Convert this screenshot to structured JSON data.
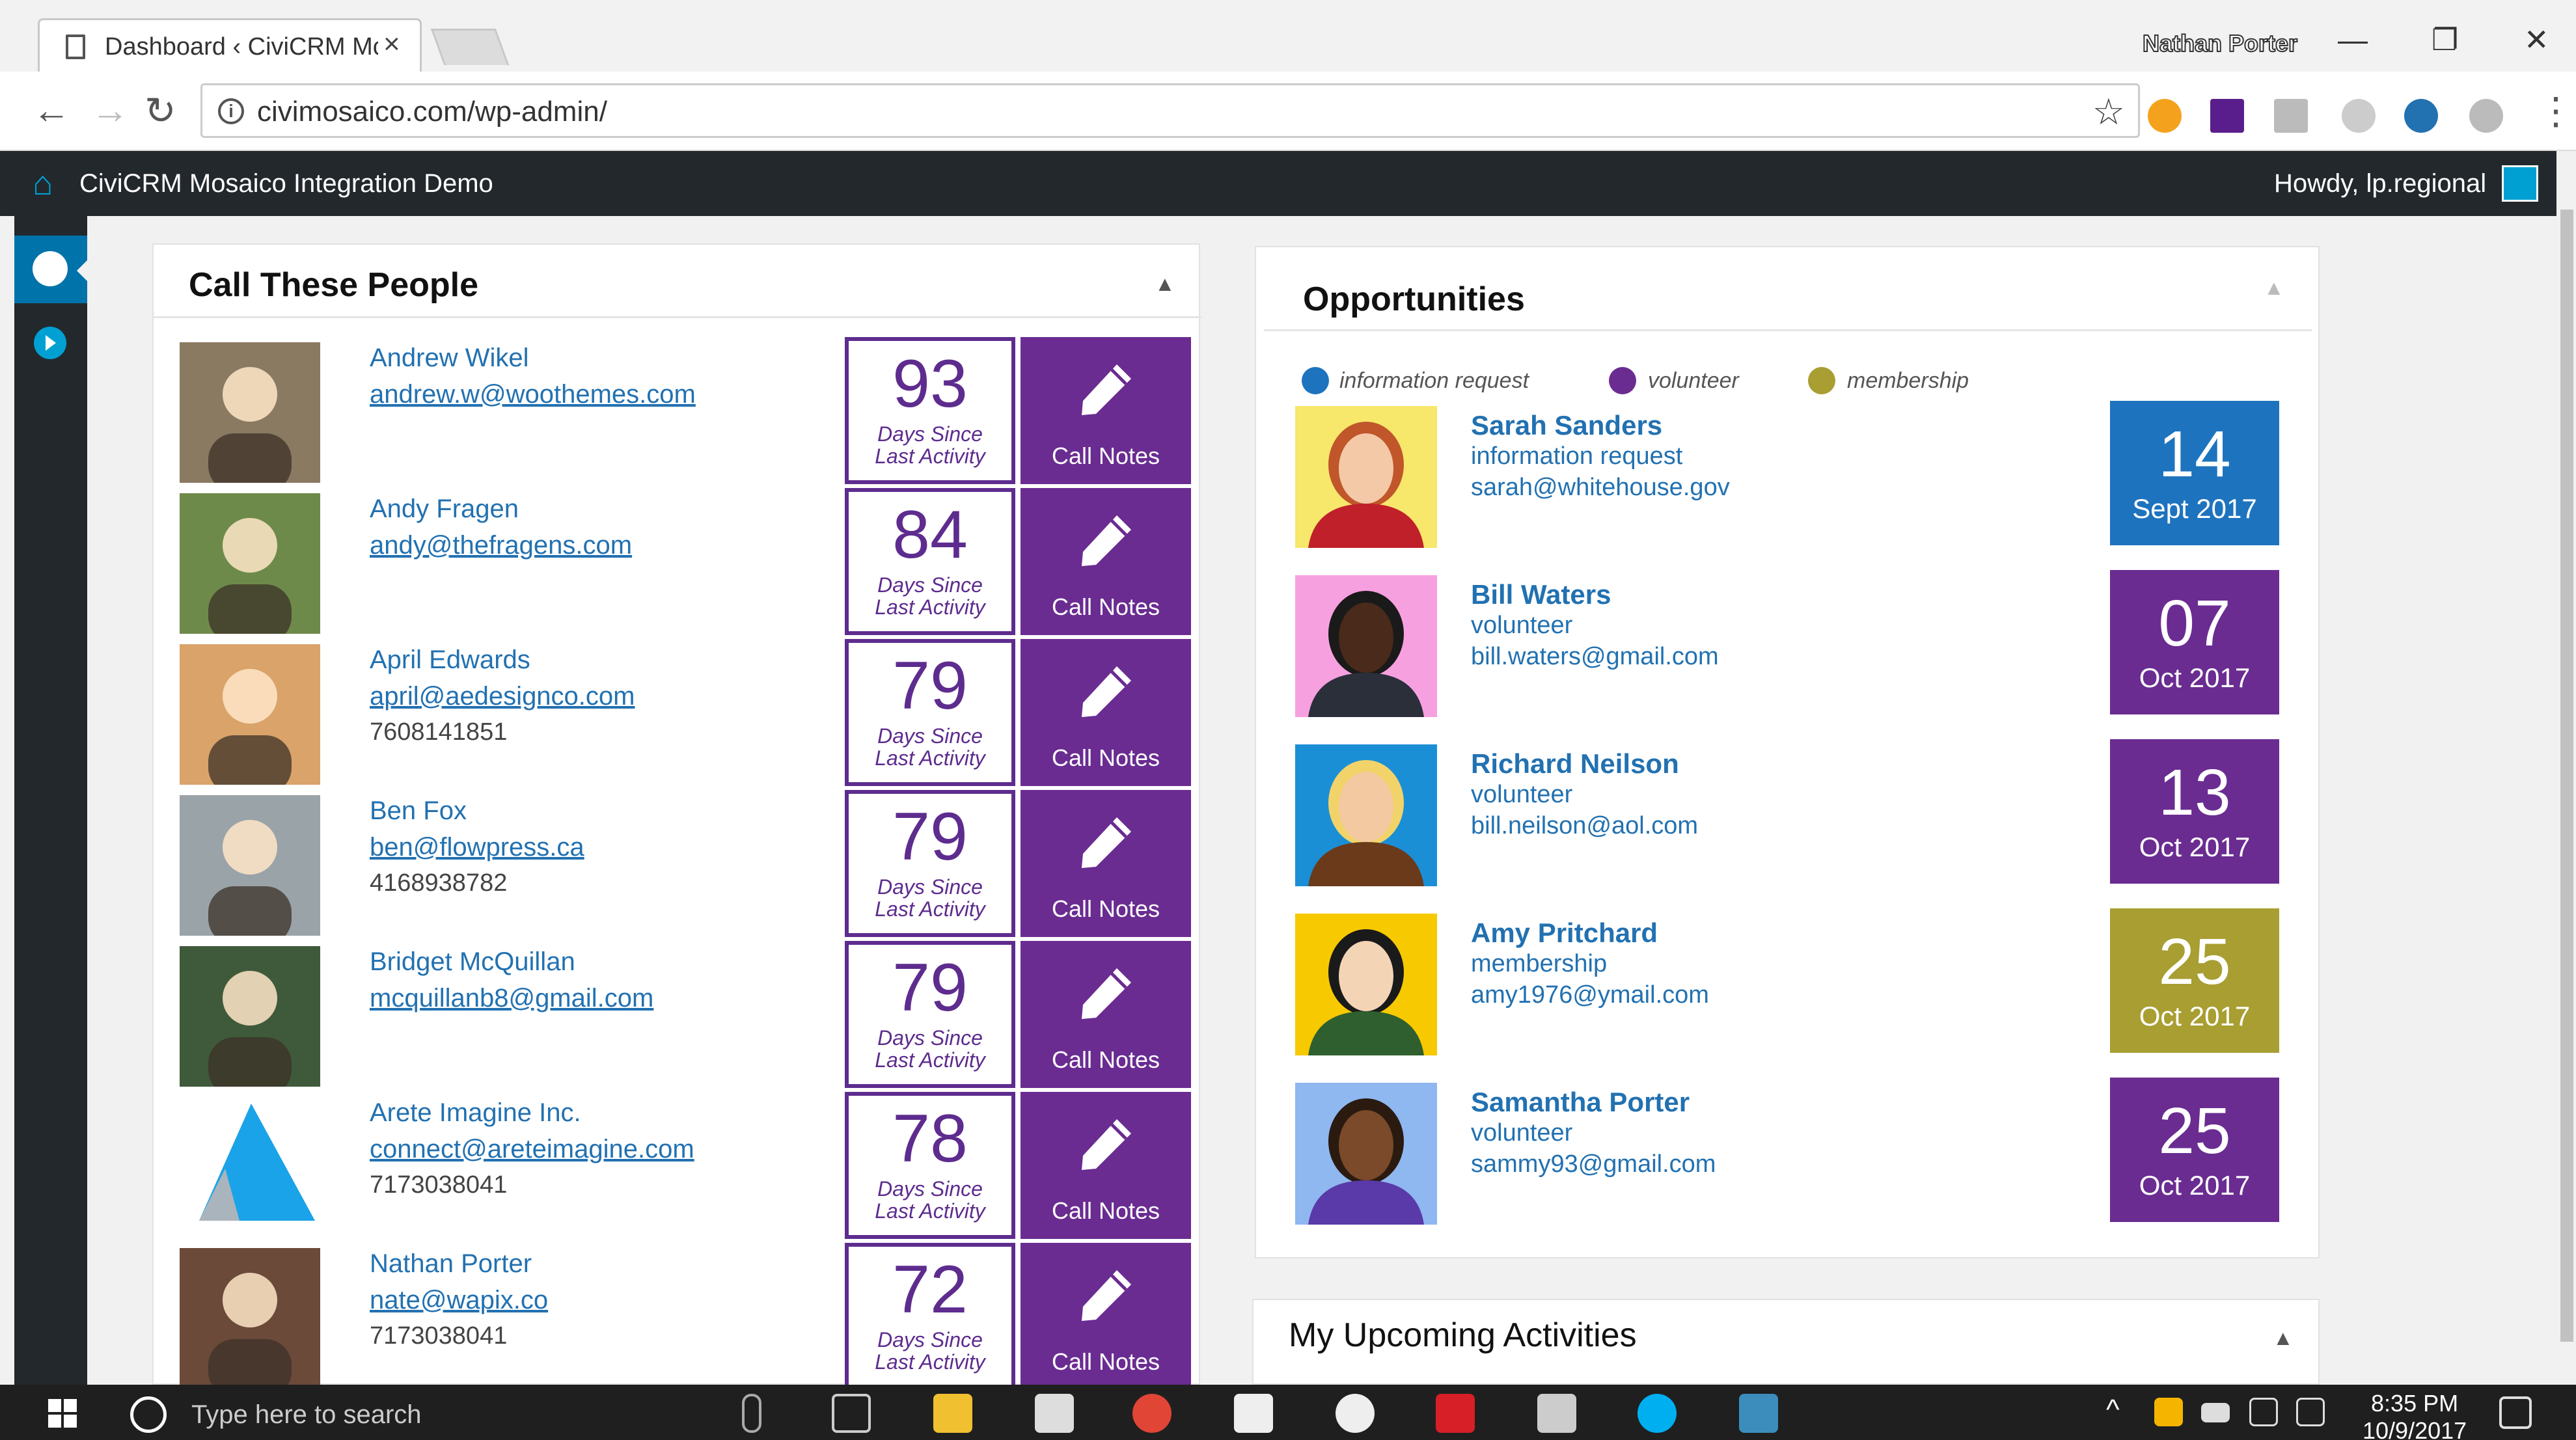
{
  "browser": {
    "tab_title": "Dashboard ‹ CiviCRM Mc",
    "tab_close": "×",
    "profile_name": "Nathan Porter",
    "url": "civimosaico.com/wp-admin/"
  },
  "adminbar": {
    "site_name": "CiviCRM Mosaico Integration Demo",
    "howdy": "Howdy, lp.regional"
  },
  "call_panel": {
    "title": "Call These People",
    "days_label_1": "Days Since",
    "days_label_2": "Last Activity",
    "notes_label": "Call Notes",
    "people": [
      {
        "name": "Andrew Wikel",
        "email": "andrew.w@woothemes.com",
        "phone": "",
        "days": "93"
      },
      {
        "name": "Andy Fragen",
        "email": "andy@thefragens.com",
        "phone": "",
        "days": "84"
      },
      {
        "name": "April Edwards",
        "email": "april@aedesignco.com",
        "phone": "7608141851",
        "days": "79"
      },
      {
        "name": "Ben Fox",
        "email": "ben@flowpress.ca",
        "phone": "4168938782",
        "days": "79"
      },
      {
        "name": "Bridget McQuillan",
        "email": "mcquillanb8@gmail.com",
        "phone": "",
        "days": "79"
      },
      {
        "name": "Arete Imagine Inc.",
        "email": "connect@areteimagine.com",
        "phone": "7173038041",
        "days": "78"
      },
      {
        "name": "Nathan Porter",
        "email": "nate@wapix.co",
        "phone": "7173038041",
        "days": "72"
      }
    ]
  },
  "opportunities": {
    "title": "Opportunities",
    "legend": [
      {
        "label": "information request",
        "color": "#1e73be"
      },
      {
        "label": "volunteer",
        "color": "#6a2c91"
      },
      {
        "label": "membership",
        "color": "#a89e32"
      }
    ],
    "items": [
      {
        "name": "Sarah Sanders",
        "type": "information request",
        "email": "sarah@whitehouse.gov",
        "day": "14",
        "month": "Sept 2017",
        "color": "#1e73be"
      },
      {
        "name": "Bill Waters",
        "type": "volunteer",
        "email": "bill.waters@gmail.com",
        "day": "07",
        "month": "Oct 2017",
        "color": "#6a2c91"
      },
      {
        "name": "Richard Neilson",
        "type": "volunteer",
        "email": "bill.neilson@aol.com",
        "day": "13",
        "month": "Oct 2017",
        "color": "#6a2c91"
      },
      {
        "name": "Amy Pritchard",
        "type": "membership",
        "email": "amy1976@ymail.com",
        "day": "25",
        "month": "Oct 2017",
        "color": "#a89e32"
      },
      {
        "name": "Samantha Porter",
        "type": "volunteer",
        "email": "sammy93@gmail.com",
        "day": "25",
        "month": "Oct 2017",
        "color": "#6a2c91"
      }
    ]
  },
  "activities": {
    "title": "My Upcoming Activities"
  },
  "taskbar": {
    "search_placeholder": "Type here to search",
    "time": "8:35 PM",
    "date": "10/9/2017"
  },
  "colors": {
    "purple": "#6a2c91",
    "blue": "#1e73be",
    "olive": "#a89e32",
    "admin_dark": "#23282d"
  }
}
